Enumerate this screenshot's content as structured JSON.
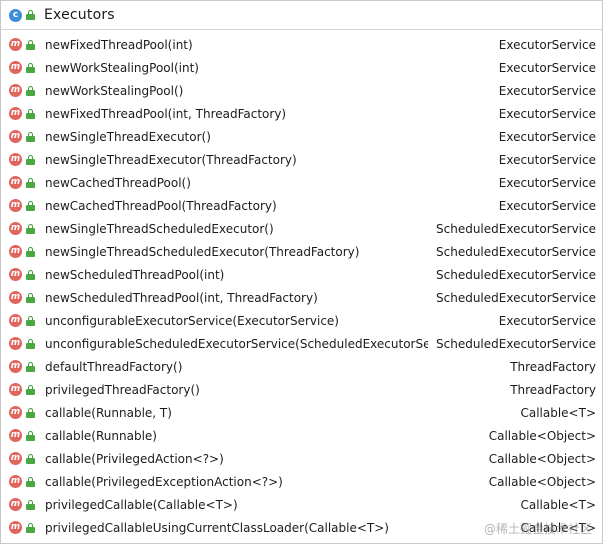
{
  "header": {
    "title": "Executors",
    "class_icon_letter": "c"
  },
  "method_icon_letter": "m",
  "methods": [
    {
      "signature": "newFixedThreadPool(int)",
      "return_type": "ExecutorService"
    },
    {
      "signature": "newWorkStealingPool(int)",
      "return_type": "ExecutorService"
    },
    {
      "signature": "newWorkStealingPool()",
      "return_type": "ExecutorService"
    },
    {
      "signature": "newFixedThreadPool(int, ThreadFactory)",
      "return_type": "ExecutorService"
    },
    {
      "signature": "newSingleThreadExecutor()",
      "return_type": "ExecutorService"
    },
    {
      "signature": "newSingleThreadExecutor(ThreadFactory)",
      "return_type": "ExecutorService"
    },
    {
      "signature": "newCachedThreadPool()",
      "return_type": "ExecutorService"
    },
    {
      "signature": "newCachedThreadPool(ThreadFactory)",
      "return_type": "ExecutorService"
    },
    {
      "signature": "newSingleThreadScheduledExecutor()",
      "return_type": "ScheduledExecutorService"
    },
    {
      "signature": "newSingleThreadScheduledExecutor(ThreadFactory)",
      "return_type": "ScheduledExecutorService"
    },
    {
      "signature": "newScheduledThreadPool(int)",
      "return_type": "ScheduledExecutorService"
    },
    {
      "signature": "newScheduledThreadPool(int, ThreadFactory)",
      "return_type": "ScheduledExecutorService"
    },
    {
      "signature": "unconfigurableExecutorService(ExecutorService)",
      "return_type": "ExecutorService"
    },
    {
      "signature": "unconfigurableScheduledExecutorService(ScheduledExecutorService)",
      "return_type": "ScheduledExecutorService"
    },
    {
      "signature": "defaultThreadFactory()",
      "return_type": "ThreadFactory"
    },
    {
      "signature": "privilegedThreadFactory()",
      "return_type": "ThreadFactory"
    },
    {
      "signature": "callable(Runnable, T)",
      "return_type": "Callable<T>"
    },
    {
      "signature": "callable(Runnable)",
      "return_type": "Callable<Object>"
    },
    {
      "signature": "callable(PrivilegedAction<?>)",
      "return_type": "Callable<Object>"
    },
    {
      "signature": "callable(PrivilegedExceptionAction<?>)",
      "return_type": "Callable<Object>"
    },
    {
      "signature": "privilegedCallable(Callable<T>)",
      "return_type": "Callable<T>"
    },
    {
      "signature": "privilegedCallableUsingCurrentClassLoader(Callable<T>)",
      "return_type": "Callable<T>"
    }
  ],
  "watermark": "@稀土掘金技术社区",
  "colors": {
    "class_icon": "#3c8fd6",
    "method_icon": "#e0655f",
    "public_lock": "#4aa843"
  }
}
